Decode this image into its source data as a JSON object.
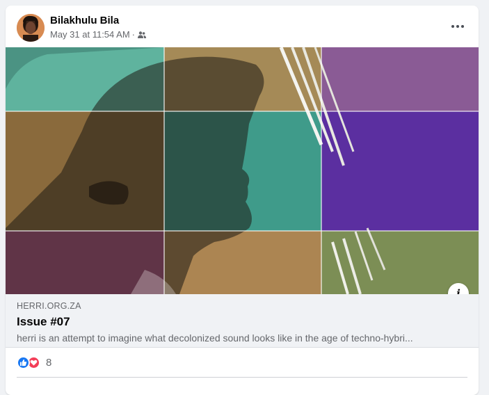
{
  "post": {
    "author": "Bilakhulu Bila",
    "timestamp": "May 31 at 11:54 AM",
    "separator": "·",
    "audience_icon": "friends-icon",
    "more_icon": "more-options-icon"
  },
  "link": {
    "domain": "HERRI.ORG.ZA",
    "title": "Issue #07",
    "description": "herri is an attempt to imagine what decolonized sound looks like in the age of techno-hybri...",
    "info_label": "i"
  },
  "reactions": {
    "types": [
      "like",
      "love"
    ],
    "count": "8",
    "like_color": "#1877f2",
    "love_color": "#f33e58"
  }
}
